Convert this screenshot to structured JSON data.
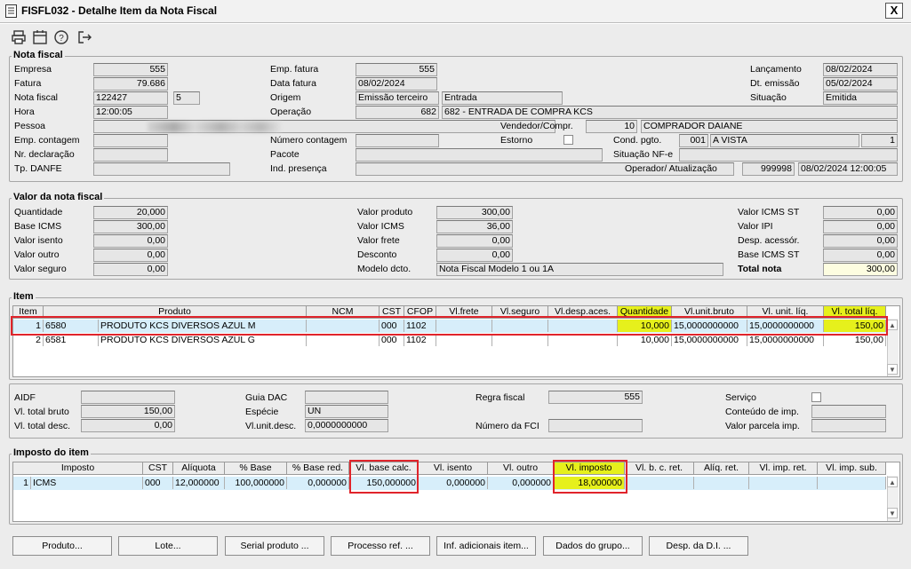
{
  "window": {
    "title": "FISFL032 - Detalhe Item da Nota Fiscal",
    "close": "X"
  },
  "toolbar": {
    "icons": [
      "printer-icon",
      "calendar-icon",
      "help-icon",
      "exit-icon"
    ]
  },
  "nota_fiscal": {
    "section_title": "Nota fiscal",
    "labels": {
      "empresa": "Empresa",
      "fatura": "Fatura",
      "nota_fiscal": "Nota fiscal",
      "hora": "Hora",
      "pessoa": "Pessoa",
      "emp_contagem": "Emp. contagem",
      "nr_declaracao": "Nr. declaração",
      "tp_danfe": "Tp. DANFE",
      "emp_fatura": "Emp. fatura",
      "data_fatura": "Data fatura",
      "origem": "Origem",
      "operacao": "Operação",
      "numero_contagem": "Número contagem",
      "pacote": "Pacote",
      "ind_presenca": "Ind. presença",
      "vendedor": "Vendedor/Compr.",
      "estorno": "Estorno",
      "cond_pgto": "Cond. pgto.",
      "situacao_nfe": "Situação NF-e",
      "operador": "Operador/ Atualização",
      "lancamento": "Lançamento",
      "dt_emissao": "Dt. emissão",
      "situacao": "Situação"
    },
    "values": {
      "empresa": "555",
      "fatura": "79.686",
      "nota_fiscal": "122427",
      "serie": "5",
      "hora": "12:00:05",
      "emp_fatura": "555",
      "data_fatura": "08/02/2024",
      "origem": "Emissão terceiro",
      "origem_tipo": "Entrada",
      "operacao_cod": "682",
      "operacao_desc": "682 - ENTRADA DE COMPRA KCS",
      "vendedor_cod": "10",
      "vendedor_nome": "COMPRADOR DAIANE",
      "cond_pgto_cod": "001",
      "cond_pgto_desc": "A VISTA",
      "cond_pgto_parc": "1",
      "operador": "999998",
      "atualizacao": "08/02/2024 12:00:05",
      "lancamento": "08/02/2024",
      "dt_emissao": "05/02/2024",
      "situacao": "Emitida"
    }
  },
  "valor_nota": {
    "section_title": "Valor da nota fiscal",
    "col1": [
      {
        "label": "Quantidade",
        "value": "20,000"
      },
      {
        "label": "Base ICMS",
        "value": "300,00"
      },
      {
        "label": "Valor isento",
        "value": "0,00"
      },
      {
        "label": "Valor outro",
        "value": "0,00"
      },
      {
        "label": "Valor seguro",
        "value": "0,00"
      }
    ],
    "col2": [
      {
        "label": "Valor produto",
        "value": "300,00"
      },
      {
        "label": "Valor ICMS",
        "value": "36,00"
      },
      {
        "label": "Valor frete",
        "value": "0,00"
      },
      {
        "label": "Desconto",
        "value": "0,00"
      }
    ],
    "modelo_label": "Modelo dcto.",
    "modelo_value": "Nota Fiscal Modelo 1 ou 1A",
    "col3": [
      {
        "label": "Valor ICMS ST",
        "value": "0,00"
      },
      {
        "label": "Valor IPI",
        "value": "0,00"
      },
      {
        "label": "Desp. acessór.",
        "value": "0,00"
      },
      {
        "label": "Base ICMS ST",
        "value": "0,00"
      }
    ],
    "total_label": "Total nota",
    "total_value": "300,00"
  },
  "item": {
    "section_title": "Item",
    "headers": [
      "Item",
      "Produto",
      "NCM",
      "CST",
      "CFOP",
      "Vl.frete",
      "Vl.seguro",
      "Vl.desp.aces.",
      "Quantidade",
      "Vl.unit.bruto",
      "Vl. unit. líq.",
      "Vl. total líq."
    ],
    "rows": [
      [
        "1",
        "6580",
        "PRODUTO KCS DIVERSOS AZUL M",
        "",
        "000",
        "1102",
        "",
        "",
        "",
        "10,000",
        "15,0000000000",
        "15,0000000000",
        "150,00"
      ],
      [
        "2",
        "6581",
        "PRODUTO KCS DIVERSOS AZUL G",
        "",
        "000",
        "1102",
        "",
        "",
        "",
        "10,000",
        "15,0000000000",
        "15,0000000000",
        "150,00"
      ]
    ]
  },
  "detalhe": {
    "aidf": "AIDF",
    "vl_total_bruto": "Vl. total bruto",
    "vl_total_bruto_value": "150,00",
    "vl_total_desc": "Vl. total desc.",
    "vl_total_desc_value": "0,00",
    "guia_dac": "Guia DAC",
    "especie": "Espécie",
    "especie_value": "UN",
    "vl_unit_desc": "Vl.unit.desc.",
    "vl_unit_desc_value": "0,0000000000",
    "regra_fiscal": "Regra fiscal",
    "regra_fiscal_value": "555",
    "numero_fci": "Número da FCI",
    "servico": "Serviço",
    "conteudo_imp": "Conteúdo de imp.",
    "valor_parcela_imp": "Valor parcela imp."
  },
  "imposto": {
    "section_title": "Imposto do item",
    "headers": [
      "Imposto",
      "CST",
      "Alíquota",
      "% Base",
      "% Base red.",
      "Vl. base calc.",
      "Vl. isento",
      "Vl. outro",
      "Vl. imposto",
      "Vl. b. c. ret.",
      "Alíq. ret.",
      "Vl. imp. ret.",
      "Vl. imp. sub."
    ],
    "row": [
      "1",
      "ICMS",
      "000",
      "12,000000",
      "100,000000",
      "0,000000",
      "150,000000",
      "0,000000",
      "0,000000",
      "18,000000",
      "",
      "",
      "",
      ""
    ]
  },
  "buttons": [
    "Produto...",
    "Lote...",
    "Serial produto ...",
    "Processo ref. ...",
    "Inf. adicionais item...",
    "Dados do grupo...",
    "Desp. da D.I. ..."
  ],
  "highlight_color": "#e6f01c",
  "annotation_color": "#e0242b"
}
